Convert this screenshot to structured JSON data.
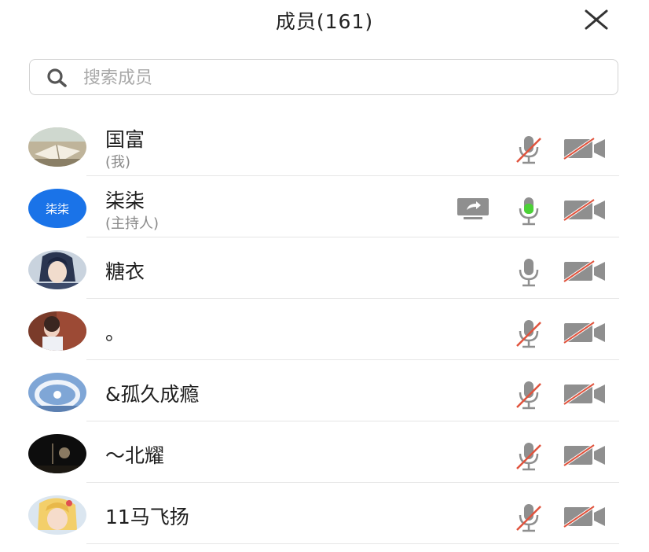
{
  "header": {
    "title": "成员(161)"
  },
  "search": {
    "placeholder": "搜索成员",
    "value": ""
  },
  "members": [
    {
      "name": "国富",
      "sub": "(我)",
      "avatar": "book-photo",
      "mic": "muted",
      "cam": "off",
      "sharing": false
    },
    {
      "name": "柒柒",
      "sub": "(主持人)",
      "avatar_text": "柒柒",
      "mic": "speaking",
      "cam": "off",
      "sharing": true
    },
    {
      "name": "糖衣",
      "sub": "",
      "avatar": "anime-boy",
      "mic": "on",
      "cam": "off",
      "sharing": false
    },
    {
      "name": "。",
      "sub": "",
      "avatar": "portrait-photo",
      "mic": "muted",
      "cam": "off",
      "sharing": false
    },
    {
      "name": "&孤久成瘾",
      "sub": "",
      "avatar": "ring-photo",
      "mic": "muted",
      "cam": "off",
      "sharing": false
    },
    {
      "name": "～北耀",
      "sub": "",
      "avatar": "dark-photo",
      "mic": "muted",
      "cam": "off",
      "sharing": false
    },
    {
      "name": "11马飞扬",
      "sub": "",
      "avatar": "anime-blonde",
      "mic": "muted",
      "cam": "off",
      "sharing": false
    }
  ],
  "colors": {
    "accent": "#1a73e8",
    "mic_active": "#4cd137",
    "muted_slash": "#e0533d",
    "icon_gray": "#8f8f8f"
  }
}
